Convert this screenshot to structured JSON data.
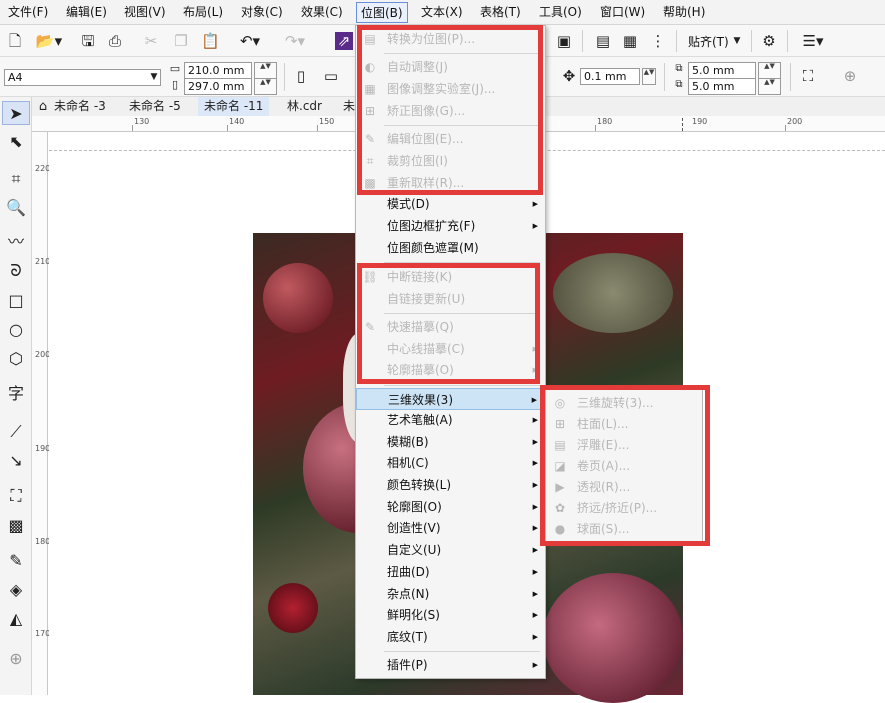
{
  "menubar": {
    "items": [
      {
        "label": "文件(F)"
      },
      {
        "label": "编辑(E)"
      },
      {
        "label": "视图(V)"
      },
      {
        "label": "布局(L)"
      },
      {
        "label": "对象(C)"
      },
      {
        "label": "效果(C)"
      },
      {
        "label": "位图(B)",
        "active": true
      },
      {
        "label": "文本(X)"
      },
      {
        "label": "表格(T)"
      },
      {
        "label": "工具(O)"
      },
      {
        "label": "窗口(W)"
      },
      {
        "label": "帮助(H)"
      }
    ]
  },
  "toolbar": {
    "snap_label": "贴齐(T)"
  },
  "property_bar": {
    "page_size": "A4",
    "width": "210.0 mm",
    "height": "297.0 mm",
    "nudge": "0.1 mm",
    "dup_x": "5.0 mm",
    "dup_y": "5.0 mm"
  },
  "tabs": [
    {
      "label": "未命名 -3"
    },
    {
      "label": "未命名 -5"
    },
    {
      "label": "未命名 -11",
      "active": true
    },
    {
      "label": "林.cdr"
    },
    {
      "label": "未"
    }
  ],
  "ruler": {
    "top_labels": [
      "130",
      "140",
      "150",
      "180",
      "190",
      "200"
    ],
    "left_labels": [
      "220",
      "210",
      "200",
      "190",
      "180",
      "170"
    ]
  },
  "bitmap_menu": {
    "items": [
      {
        "label": "转换为位图(P)...",
        "disabled": true,
        "icon": "convert-icon"
      },
      {
        "label": "自动调整(J)",
        "disabled": true,
        "icon": "auto-adjust-icon"
      },
      {
        "label": "图像调整实验室(J)...",
        "disabled": true,
        "icon": "image-lab-icon"
      },
      {
        "label": "矫正图像(G)...",
        "disabled": true,
        "icon": "straighten-icon"
      },
      {
        "label": "编辑位图(E)...",
        "disabled": true,
        "icon": "edit-bitmap-icon"
      },
      {
        "label": "裁剪位图(I)",
        "disabled": true,
        "icon": "crop-bitmap-icon"
      },
      {
        "label": "重新取样(R)...",
        "disabled": true,
        "icon": "resample-icon"
      },
      {
        "label": "模式(D)",
        "submenu": true
      },
      {
        "label": "位图边框扩充(F)",
        "submenu": true
      },
      {
        "label": "位图颜色遮罩(M)"
      },
      {
        "label": "中断链接(K)",
        "disabled": true,
        "icon": "break-link-icon"
      },
      {
        "label": "自链接更新(U)",
        "disabled": true
      },
      {
        "label": "快速描摹(Q)",
        "disabled": true,
        "icon": "quick-trace-icon"
      },
      {
        "label": "中心线描摹(C)",
        "disabled": true,
        "submenu": true
      },
      {
        "label": "轮廓描摹(O)",
        "disabled": true,
        "submenu": true
      },
      {
        "label": "三维效果(3)",
        "submenu": true,
        "highlighted": true
      },
      {
        "label": "艺术笔触(A)",
        "submenu": true
      },
      {
        "label": "模糊(B)",
        "submenu": true
      },
      {
        "label": "相机(C)",
        "submenu": true
      },
      {
        "label": "颜色转换(L)",
        "submenu": true
      },
      {
        "label": "轮廓图(O)",
        "submenu": true
      },
      {
        "label": "创造性(V)",
        "submenu": true
      },
      {
        "label": "自定义(U)",
        "submenu": true
      },
      {
        "label": "扭曲(D)",
        "submenu": true
      },
      {
        "label": "杂点(N)",
        "submenu": true
      },
      {
        "label": "鲜明化(S)",
        "submenu": true
      },
      {
        "label": "底纹(T)",
        "submenu": true
      },
      {
        "label": "插件(P)",
        "submenu": true
      }
    ]
  },
  "submenu_3d": {
    "items": [
      {
        "label": "三维旋转(3)...",
        "icon": "3d-rotate-icon"
      },
      {
        "label": "柱面(L)...",
        "icon": "cylinder-icon"
      },
      {
        "label": "浮雕(E)...",
        "icon": "emboss-icon"
      },
      {
        "label": "卷页(A)...",
        "icon": "page-curl-icon"
      },
      {
        "label": "透视(R)...",
        "icon": "perspective-icon"
      },
      {
        "label": "挤远/挤近(P)...",
        "icon": "pinch-punch-icon"
      },
      {
        "label": "球面(S)...",
        "icon": "sphere-icon"
      }
    ]
  },
  "colors": {
    "highlight_box": "#e33a3a",
    "menu_hover": "#cde4f7"
  }
}
